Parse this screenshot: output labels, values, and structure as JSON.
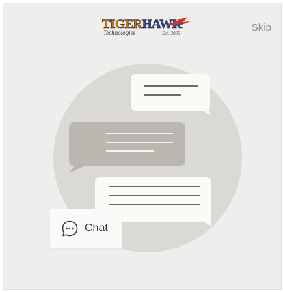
{
  "header": {
    "logo": {
      "word_part1": "TIGER",
      "word_part2": "HAWK",
      "tagline": "Technologies",
      "established": "Est. 2005"
    },
    "skip_label": "Skip"
  },
  "illustration": {
    "circle_color": "#dad9d5",
    "bubble_light_color": "#fbfaf7",
    "bubble_dark_color": "#b9b7b0",
    "line_color_on_light": "#6d6c69",
    "line_color_on_dark": "#f4f3f1"
  },
  "chat": {
    "icon": "chat-bubble-ellipsis-icon",
    "label": "Chat"
  },
  "colors": {
    "background": "#efeeec",
    "text_muted": "#8d8c89"
  }
}
